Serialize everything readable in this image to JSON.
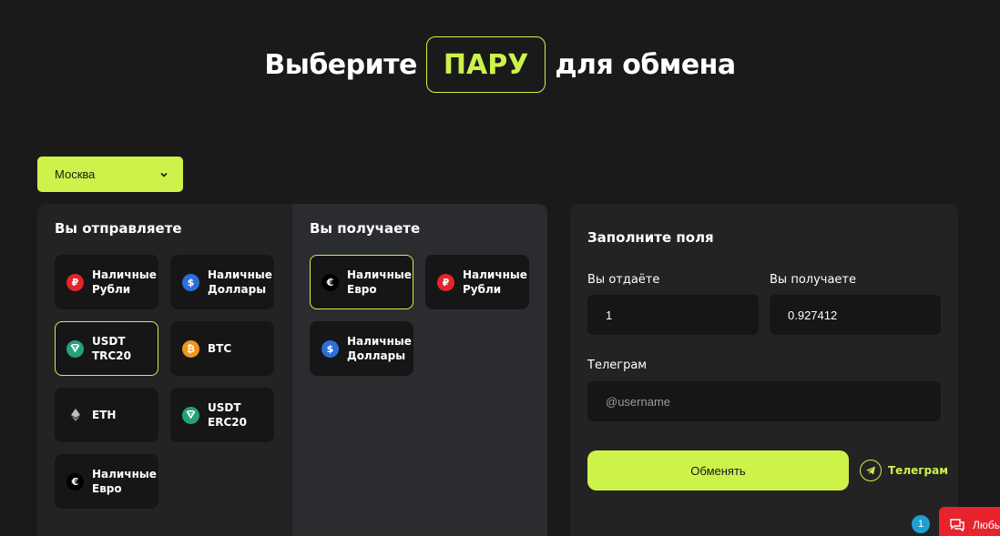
{
  "header": {
    "title_left": "Выберите",
    "title_pill": "ПАРУ",
    "title_right": "для обмена"
  },
  "city": {
    "selected": "Москва",
    "icon": "chevron-down-icon"
  },
  "send": {
    "title": "Вы отправляете",
    "items": [
      {
        "label": "Наличные\nРубли",
        "icon": "ruble-icon",
        "glyph": "₽",
        "color": "red"
      },
      {
        "label": "Наличные\nДоллары",
        "icon": "dollar-icon",
        "glyph": "$",
        "color": "blue"
      },
      {
        "label": "USDT\nTRC20",
        "icon": "tether-icon",
        "glyph": "T",
        "color": "teal",
        "active": true
      },
      {
        "label": "BTC",
        "icon": "bitcoin-icon",
        "glyph": "₿",
        "color": "orange"
      },
      {
        "label": "ETH",
        "icon": "ethereum-icon",
        "glyph": "◆",
        "color": "eth"
      },
      {
        "label": "USDT\nERC20",
        "icon": "tether-icon",
        "glyph": "T",
        "color": "teal"
      },
      {
        "label": "Наличные\nЕвро",
        "icon": "euro-icon",
        "glyph": "€",
        "color": "dark"
      }
    ]
  },
  "receive": {
    "title": "Вы получаете",
    "items": [
      {
        "label": "Наличные\nЕвро",
        "icon": "euro-icon",
        "glyph": "€",
        "color": "dark",
        "active": true
      },
      {
        "label": "Наличные\nРубли",
        "icon": "ruble-icon",
        "glyph": "₽",
        "color": "red"
      },
      {
        "label": "Наличные\nДоллары",
        "icon": "dollar-icon",
        "glyph": "$",
        "color": "blue"
      }
    ]
  },
  "form": {
    "title": "Заполните поля",
    "give_label": "Вы отдаёте",
    "give_value": "1",
    "get_label": "Вы получаете",
    "get_value": "0.927412",
    "telegram_label": "Телеграм",
    "telegram_placeholder": "@username",
    "submit_label": "Обменять",
    "telegram_link": "Телеграм"
  },
  "chat_widget": {
    "badge_count": "1",
    "label": "Любые"
  },
  "colors": {
    "accent": "#cdf24a",
    "background": "#1a1a1a",
    "card": "#161616",
    "chat": "#e8232d"
  }
}
